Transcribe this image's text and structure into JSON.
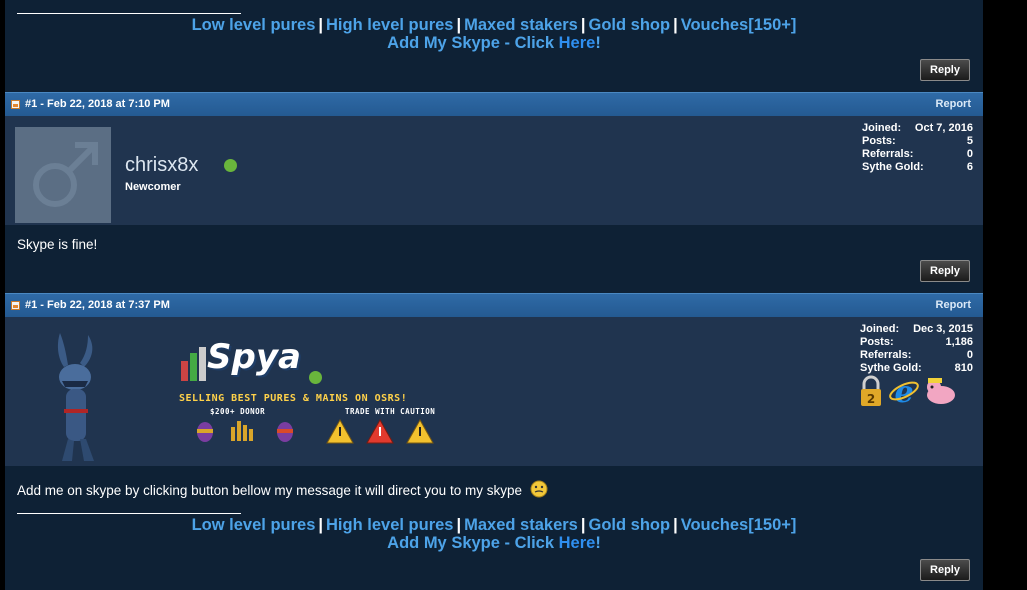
{
  "signature": {
    "links": [
      "Low level pures",
      "High level pures",
      "Maxed stakers",
      "Gold shop",
      "Vouches[150+]"
    ],
    "separator": "|",
    "skype_prefix": "Add My Skype - Click ",
    "skype_link": "Here",
    "skype_suffix": "!"
  },
  "reply_label": "Reply",
  "posts": [
    {
      "number_date": "#1 - Feb 22, 2018 at 7:10 PM",
      "report_label": "Report",
      "username": "chrisx8x",
      "rank": "Newcomer",
      "stats": [
        {
          "label": "Joined:",
          "value": "Oct 7, 2016"
        },
        {
          "label": "Posts:",
          "value": "5"
        },
        {
          "label": "Referrals:",
          "value": "0"
        },
        {
          "label": "Sythe Gold:",
          "value": "6"
        }
      ],
      "message": "Skype is fine!"
    },
    {
      "number_date": "#1 - Feb 22, 2018 at 7:37 PM",
      "report_label": "Report",
      "username_banner": "Spya",
      "banner_line": "SELLING BEST PURES & MAINS ON OSRS!",
      "banner_donor": "$200+ DONOR",
      "banner_caution": "TRADE WITH CAUTION",
      "stats": [
        {
          "label": "Joined:",
          "value": "Dec 3, 2015"
        },
        {
          "label": "Posts:",
          "value": "1,186"
        },
        {
          "label": "Referrals:",
          "value": "0"
        },
        {
          "label": "Sythe Gold:",
          "value": "810"
        }
      ],
      "badges": [
        "lock-2-icon",
        "internet-explorer-icon",
        "pink-pig-icon"
      ],
      "message": "Add me on skype by clicking button bellow my message it will direct you to my skype"
    }
  ],
  "colors": {
    "page_bg": "#0e2135",
    "userinfo_bg": "#20344f",
    "postbar_bg": "#2f6aa6",
    "link": "#4da3e8",
    "online": "#69b53c"
  }
}
